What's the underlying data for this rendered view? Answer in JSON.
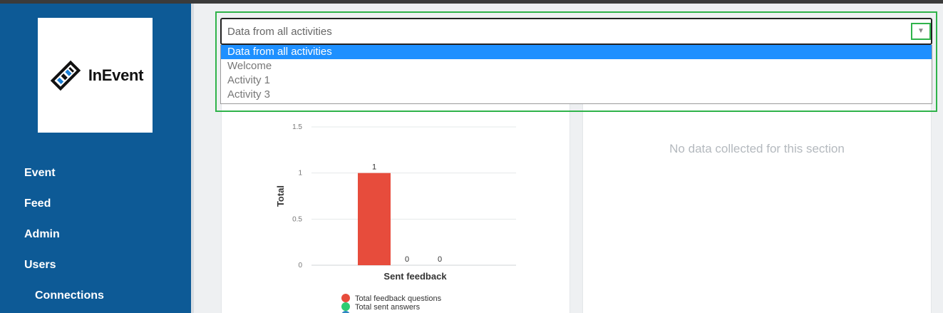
{
  "brand": {
    "name": "InEvent"
  },
  "sidebar": {
    "items": [
      {
        "label": "Event"
      },
      {
        "label": "Feed"
      },
      {
        "label": "Admin"
      },
      {
        "label": "Users"
      },
      {
        "label": "Connections"
      }
    ]
  },
  "activity_select": {
    "value": "Data from all activities",
    "options": [
      {
        "label": "Data from all activities",
        "selected": true
      },
      {
        "label": "Welcome",
        "selected": false
      },
      {
        "label": "Activity 1",
        "selected": false
      },
      {
        "label": "Activity 3",
        "selected": false
      }
    ]
  },
  "right_panel": {
    "empty_message": "No data collected for this section"
  },
  "colors": {
    "sidebar": "#0d5a96",
    "selected_option": "#1e90ff",
    "highlight": "#2fb34a",
    "series_questions": "#e74c3c",
    "series_answers": "#2ecc71",
    "series_third": "#2e86c1"
  },
  "chart_data": {
    "type": "bar",
    "title": "",
    "xlabel": "Sent feedback",
    "ylabel": "Total",
    "ylim": [
      0,
      1.5
    ],
    "yticks": [
      0,
      0.5,
      1,
      1.5
    ],
    "grid": true,
    "legend_position": "bottom",
    "categories": [
      "Sent feedback"
    ],
    "series": [
      {
        "name": "Total feedback questions",
        "values": [
          1
        ],
        "color": "#e74c3c"
      },
      {
        "name": "Total sent answers",
        "values": [
          0
        ],
        "color": "#2ecc71"
      },
      {
        "name": "",
        "values": [
          0
        ],
        "color": "#2e86c1"
      }
    ]
  }
}
